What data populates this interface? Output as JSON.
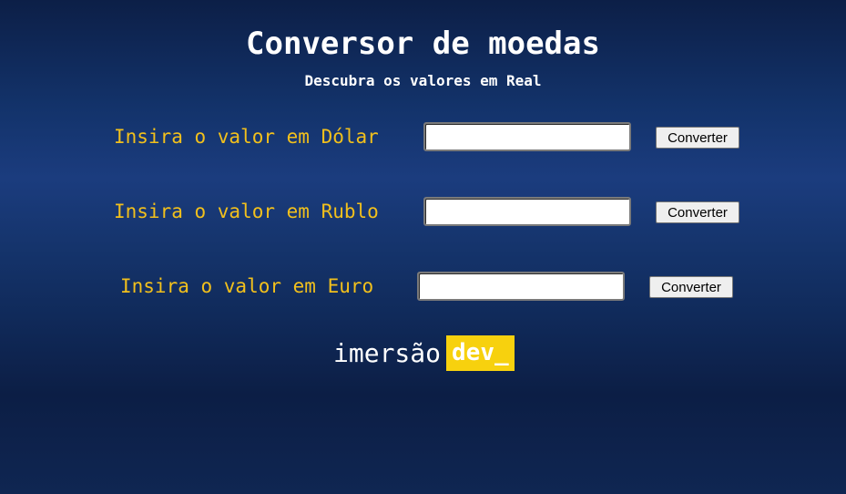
{
  "header": {
    "title": "Conversor de moedas",
    "subtitle": "Descubra os valores em Real"
  },
  "converters": [
    {
      "label": "Insira o valor em Dólar",
      "value": "",
      "button": "Converter"
    },
    {
      "label": "Insira o valor em Rublo",
      "value": "",
      "button": "Converter"
    },
    {
      "label": "Insira o valor em Euro",
      "value": "",
      "button": "Converter"
    }
  ],
  "logo": {
    "word": "imersão",
    "badge": "dev_"
  },
  "colors": {
    "label": "#f2c01c",
    "badge_background": "#f7d10e",
    "background_dark": "#0c1f47",
    "background_mid": "#1b3c7e"
  }
}
